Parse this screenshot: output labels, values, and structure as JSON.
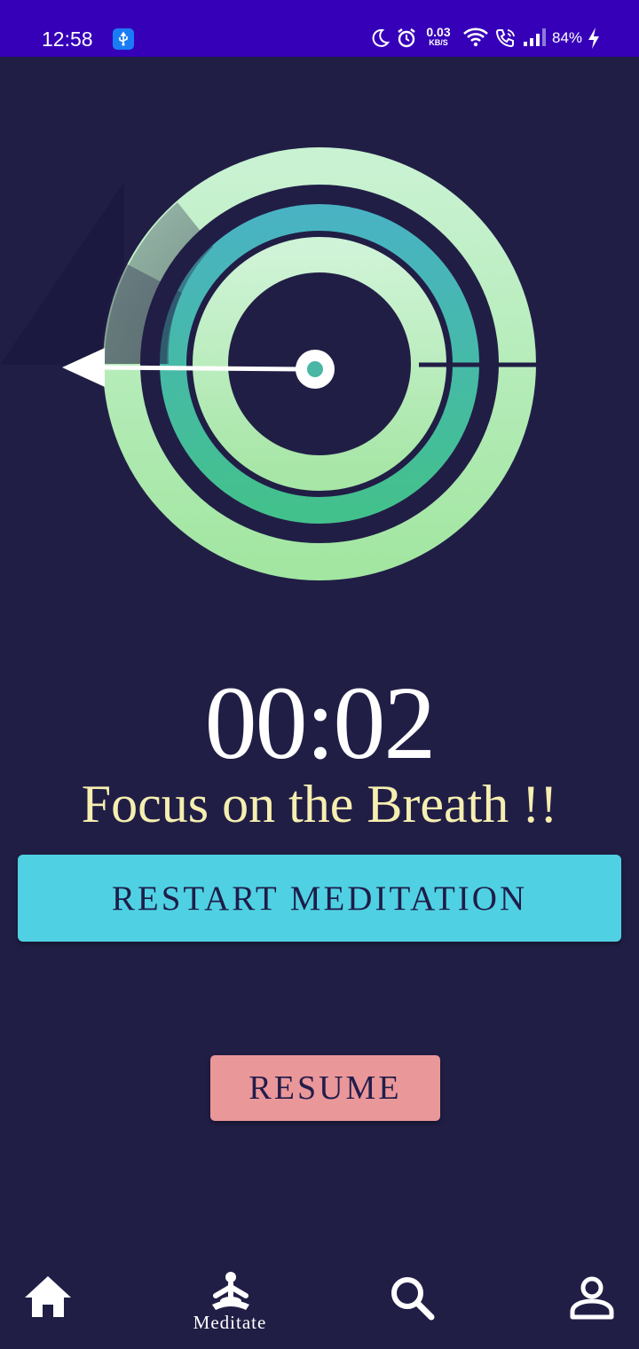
{
  "status_bar": {
    "time": "12:58",
    "data_speed": "0.03",
    "data_unit": "KB/S",
    "battery": "84%",
    "icons": [
      "usb-icon",
      "moon-icon",
      "alarm-icon",
      "wifi-icon",
      "wifi-call-icon",
      "signal-icon",
      "charging-icon"
    ]
  },
  "timer": {
    "display": "00:02"
  },
  "prompt": {
    "text": "Focus on the Breath !!"
  },
  "buttons": {
    "restart_label": "RESTART MEDITATION",
    "resume_label": "RESUME"
  },
  "nav": {
    "items": [
      {
        "icon": "home-icon",
        "label": ""
      },
      {
        "icon": "meditate-icon",
        "label": "Meditate"
      },
      {
        "icon": "search-icon",
        "label": ""
      },
      {
        "icon": "profile-icon",
        "label": ""
      }
    ]
  },
  "colors": {
    "background": "#211e46",
    "status_bar": "#3600b8",
    "restart_button": "#4fd1e3",
    "resume_button": "#ea9799",
    "prompt_text": "#f6efb0"
  }
}
